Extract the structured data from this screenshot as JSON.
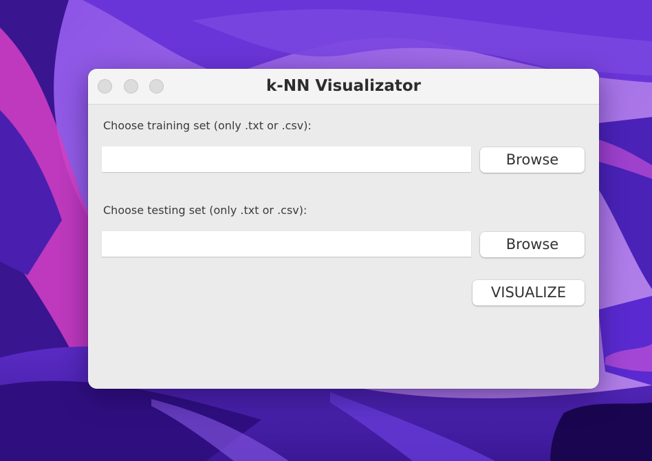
{
  "window": {
    "title": "k-NN Visualizator"
  },
  "training": {
    "label": "Choose training set (only .txt or .csv):",
    "value": "",
    "browse_label": "Browse"
  },
  "testing": {
    "label": "Choose testing set (only .txt or .csv):",
    "value": "",
    "browse_label": "Browse"
  },
  "actions": {
    "visualize_label": "VISUALIZE"
  },
  "colors": {
    "window_bg": "#ebebeb",
    "titlebar_bg": "#f4f4f4",
    "wallpaper_base": "#7b42d8",
    "wallpaper_accent": "#d63fc6"
  }
}
